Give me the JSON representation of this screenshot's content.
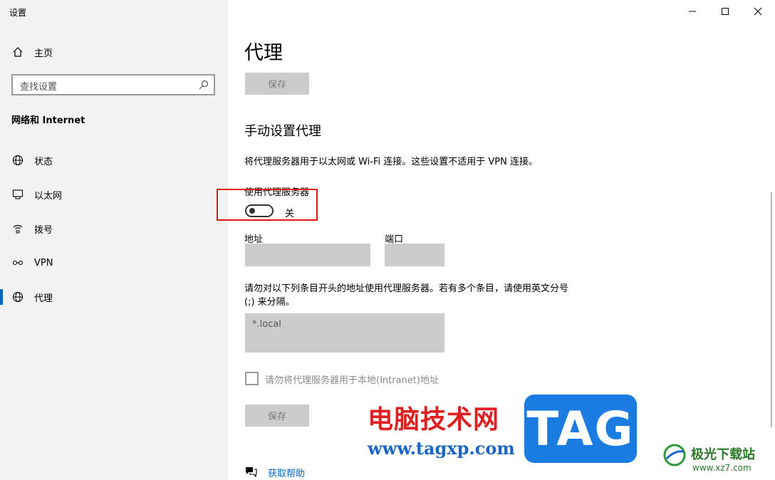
{
  "window": {
    "title": "设置",
    "controls": {
      "minimize": "minimize",
      "maximize": "maximize",
      "close": "close"
    }
  },
  "sidebar": {
    "home_label": "主页",
    "search_placeholder": "查找设置",
    "section_title": "网络和 Internet",
    "items": [
      {
        "label": "状态",
        "icon": "globe-status-icon"
      },
      {
        "label": "以太网",
        "icon": "ethernet-icon"
      },
      {
        "label": "拨号",
        "icon": "dialup-icon"
      },
      {
        "label": "VPN",
        "icon": "vpn-icon"
      },
      {
        "label": "代理",
        "icon": "globe-icon",
        "active": true
      }
    ]
  },
  "main": {
    "title": "代理",
    "save_top": "保存",
    "manual_title": "手动设置代理",
    "manual_desc": "将代理服务器用于以太网或 Wi-Fi 连接。这些设置不适用于 VPN 连接。",
    "use_proxy_label": "使用代理服务器",
    "toggle_state": "关",
    "address_label": "地址",
    "address_value": "",
    "port_label": "端口",
    "port_value": "",
    "exceptions_text": "请勿对以下列条目开头的地址使用代理服务器。若有多个条目，请使用英文分号 (;) 来分隔。",
    "exceptions_value": "*.local",
    "bypass_local_label": "请勿将代理服务器用于本地(Intranet)地址",
    "save_bottom": "保存",
    "help_label": "获取帮助"
  },
  "watermark": {
    "cn_text": "电脑技术网",
    "url": "www.tagxp.com",
    "tag": "TAG",
    "site_cn": "极光下载站",
    "site_url": "www.xz7.com"
  },
  "colors": {
    "accent": "#0067c0",
    "highlight": "#e01818",
    "disabled": "#cccccc"
  }
}
